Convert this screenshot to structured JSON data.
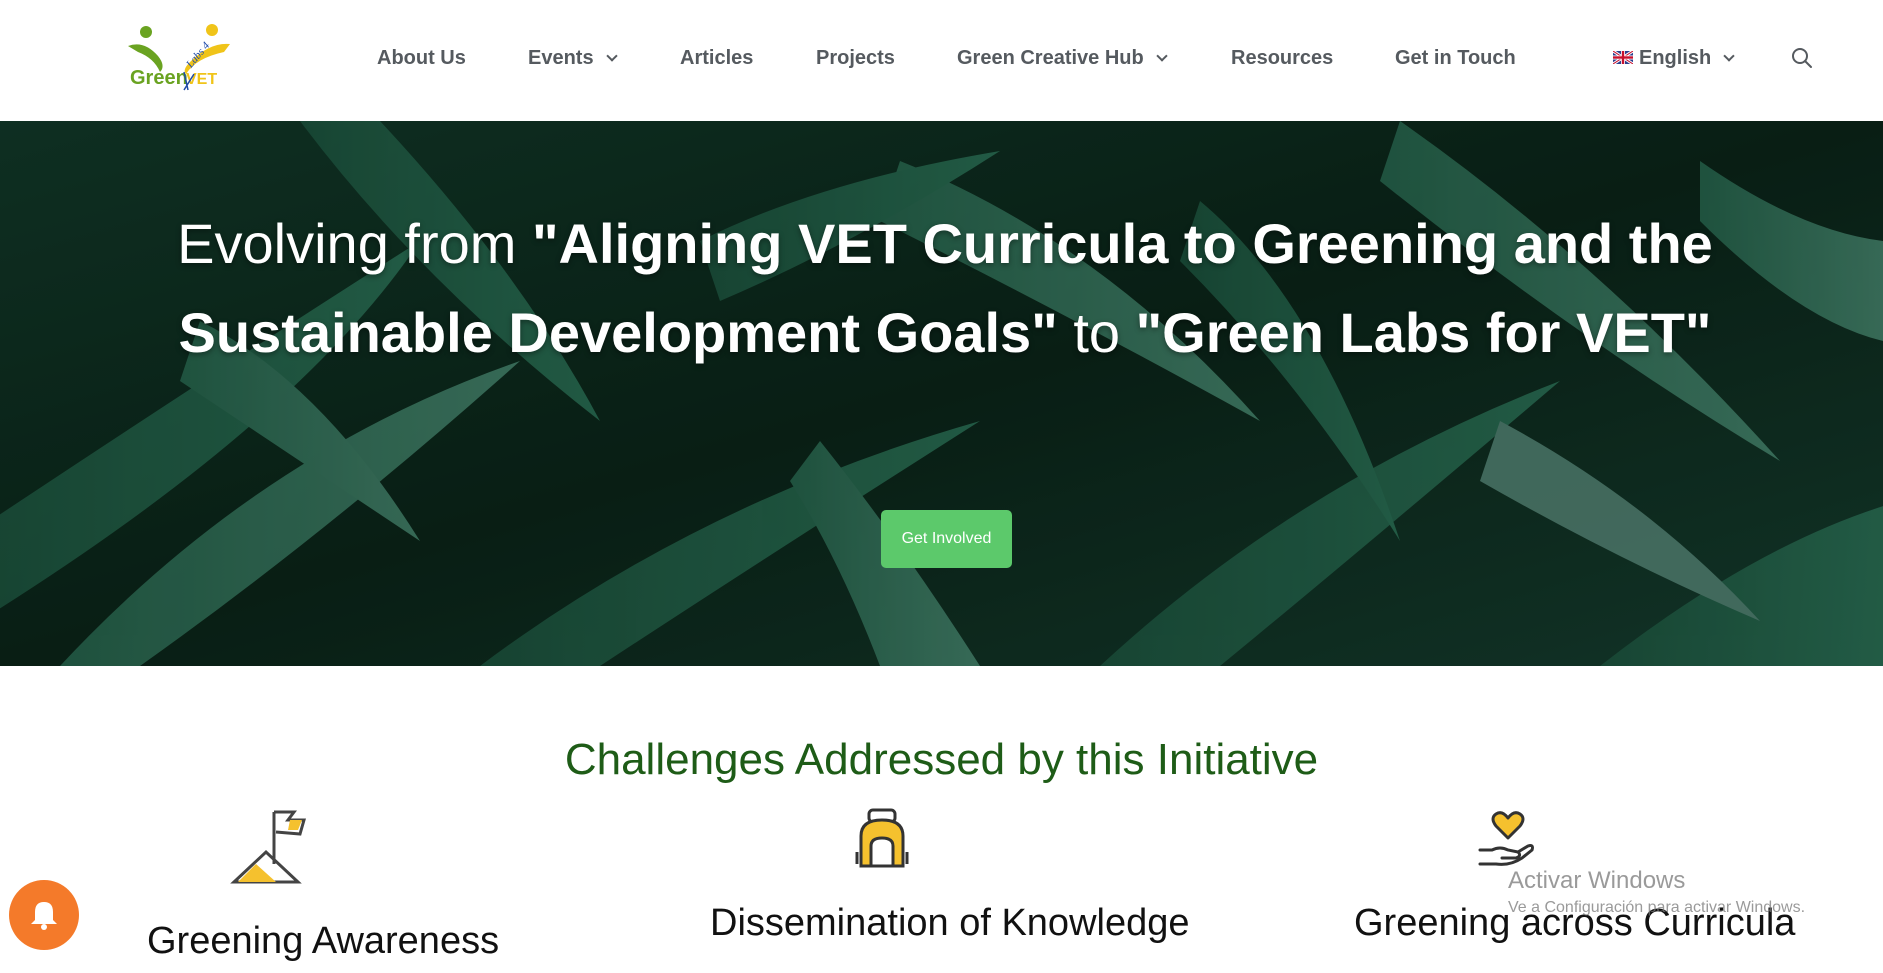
{
  "header": {
    "logo": {
      "text_main": "Green",
      "text_accent": "VET",
      "text_small": "Labs 4",
      "colors": {
        "green": "#6aa321",
        "yellow": "#f0c419",
        "blue": "#1f4aa8"
      }
    },
    "nav": {
      "about": "About Us",
      "events": "Events",
      "articles": "Articles",
      "projects": "Projects",
      "hub": "Green Creative Hub",
      "resources": "Resources",
      "contact": "Get in Touch",
      "language": "English"
    },
    "icons": {
      "language_flag": "uk-flag-icon",
      "search": "search-icon",
      "dropdown": "chevron-down-icon"
    }
  },
  "hero": {
    "title_part1": "Evolving from ",
    "title_bold1": "\"Aligning VET Curricula to Greening and the Sustainable Development Goals\"",
    "title_part2": " to ",
    "title_bold2": "\"Green Labs for VET\"",
    "cta_label": "Get Involved",
    "cta_color": "#5cc96b"
  },
  "challenges": {
    "heading": "Challenges Addressed by this Initiative",
    "heading_color": "#1e5c17",
    "cards": [
      {
        "title": "Greening Awareness",
        "icon": "mountain-flag-icon"
      },
      {
        "title": "Dissemination of Knowledge",
        "icon": "backpack-icon"
      },
      {
        "title": "Greening across Curricula",
        "icon": "heart-hand-icon"
      }
    ],
    "icon_accent_color": "#f5c12e"
  },
  "notification": {
    "icon": "bell-icon",
    "color": "#f47a2a"
  },
  "os_watermark": {
    "line1": "Activar Windows",
    "line2": "Ve a Configuración para activar Windows."
  }
}
